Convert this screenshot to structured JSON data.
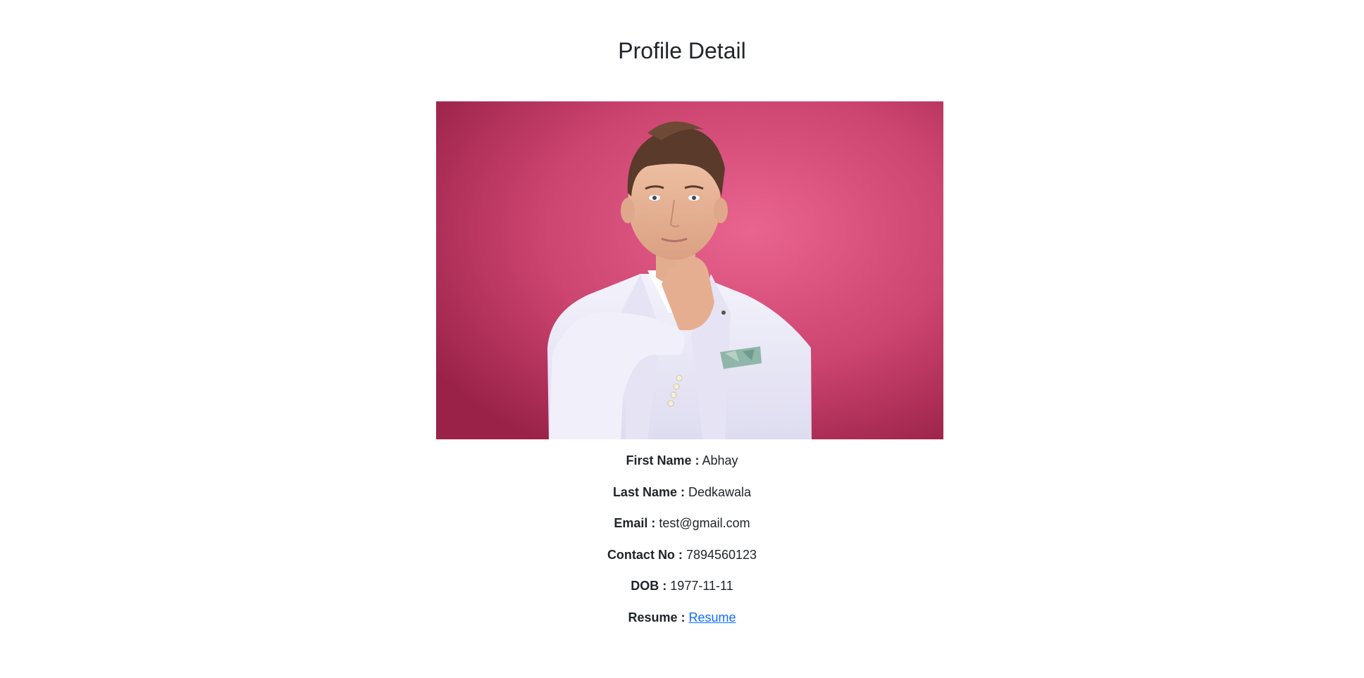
{
  "page": {
    "title": "Profile Detail"
  },
  "profile": {
    "photo_alt": "profile-photo",
    "fields": [
      {
        "label": "First Name :",
        "value": "Abhay"
      },
      {
        "label": "Last Name :",
        "value": "Dedkawala"
      },
      {
        "label": "Email :",
        "value": "test@gmail.com"
      },
      {
        "label": "Contact No :",
        "value": "7894560123"
      },
      {
        "label": "DOB :",
        "value": "1977-11-11"
      }
    ],
    "resume": {
      "label": "Resume :",
      "link_text": "Resume"
    }
  },
  "colors": {
    "background": "#ffffff",
    "text": "#212529",
    "link": "#0d6efd",
    "photo_backdrop": "#d14a78"
  }
}
